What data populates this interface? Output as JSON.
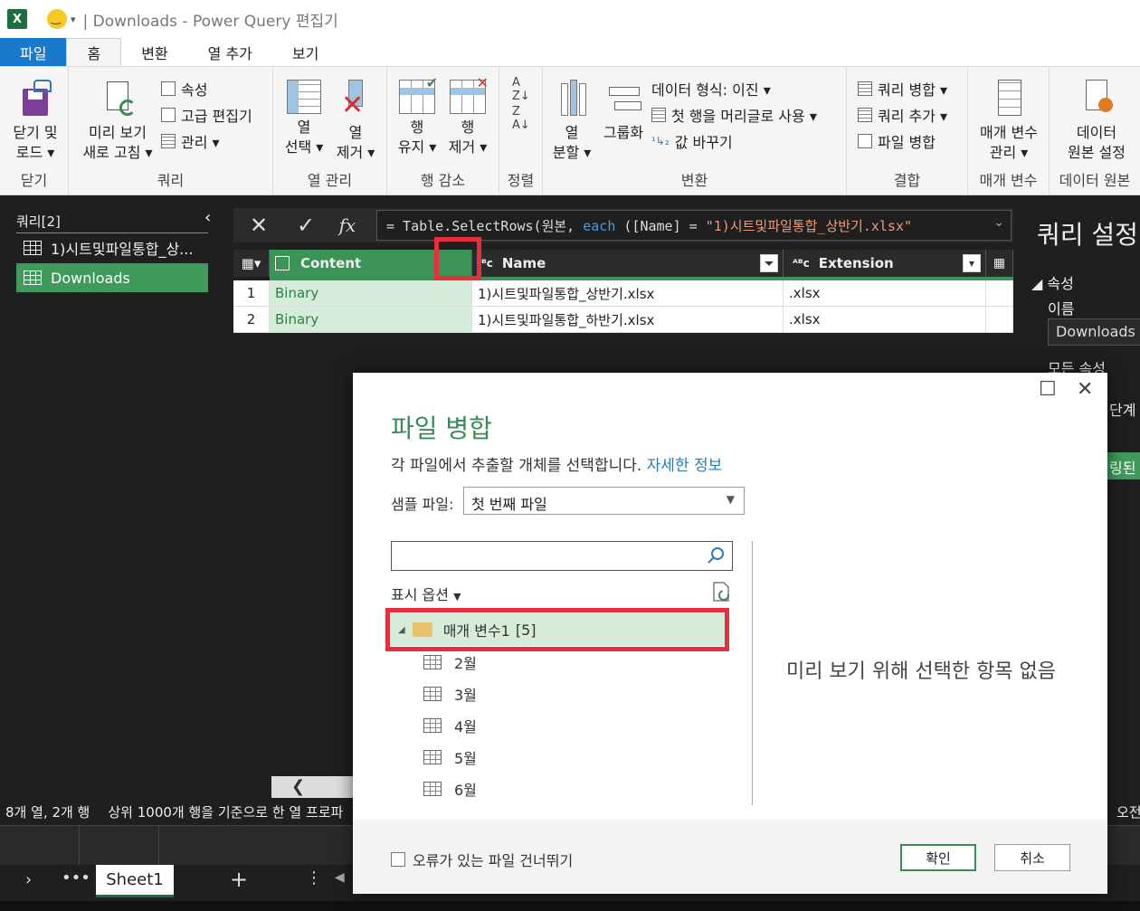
{
  "window": {
    "title": "| Downloads - Power Query 편집기",
    "app_icon": "X"
  },
  "tabs": [
    "파일",
    "홈",
    "변환",
    "열 추가",
    "보기"
  ],
  "ribbon": {
    "close_group": {
      "btn": "닫기 및",
      "btn2": "로드 ▾",
      "label": "닫기"
    },
    "query_group": {
      "refresh": "미리 보기",
      "refresh2": "새로 고침 ▾",
      "props": "속성",
      "adv": "고급 편집기",
      "manage": "관리 ▾",
      "label": "쿼리"
    },
    "cols_group": {
      "choose": "열",
      "choose2": "선택 ▾",
      "remove": "열",
      "remove2": "제거 ▾",
      "label": "열 관리"
    },
    "rows_group": {
      "keep": "행",
      "keep2": "유지 ▾",
      "remove": "행",
      "remove2": "제거 ▾",
      "label": "행 감소"
    },
    "sort_group": {
      "label": "정렬"
    },
    "transform_group": {
      "split": "열",
      "split2": "분할 ▾",
      "groupby": "그룹화",
      "dtype": "데이터 형식: 이진 ▾",
      "header": "첫 행을 머리글로 사용 ▾",
      "replace": "값 바꾸기",
      "label": "변환"
    },
    "combine_group": {
      "merge": "쿼리 병합 ▾",
      "append": "쿼리 추가 ▾",
      "files": "파일 병합",
      "label": "결합"
    },
    "params_group": {
      "manage": "매개 변수",
      "manage2": "관리 ▾",
      "label": "매개 변수"
    },
    "source_group": {
      "settings": "데이터",
      "settings2": "원본 설정",
      "label": "데이터 원본"
    }
  },
  "queries": {
    "header": "쿼리[2]",
    "items": [
      {
        "label": "1)시트및파일통합_상..."
      },
      {
        "label": "Downloads"
      }
    ]
  },
  "formula": {
    "prefix": "= Table.SelectRows(원본, ",
    "kw": "each",
    "mid": " ([Name] = ",
    "str": "\"1)시트및파일통합_상반기.xlsx\""
  },
  "grid": {
    "columns": [
      "Content",
      "Name",
      "Extension"
    ],
    "rows": [
      {
        "n": "1",
        "content": "Binary",
        "name": "1)시트및파일통합_상반기.xlsx",
        "ext": ".xlsx"
      },
      {
        "n": "2",
        "content": "Binary",
        "name": "1)시트및파일통합_하반기.xlsx",
        "ext": ".xlsx"
      }
    ]
  },
  "settings": {
    "title": "쿼리 설정",
    "props": "속성",
    "name_label": "이름",
    "name_value": "Downloads",
    "all_props": "모든 속성",
    "steps_fragment": "단계",
    "applied_fragment": "링된"
  },
  "status": {
    "left": "8개 열, 2개 행",
    "middle": "상위 1000개 행을 기준으로 한 열 프로파",
    "right": "오전"
  },
  "sheet": {
    "tab": "Sheet1"
  },
  "dialog": {
    "title": "파일 병합",
    "subtitle": "각 파일에서 추출할 개체를 선택합니다.",
    "link": "자세한 정보",
    "sample_label": "샘플 파일:",
    "sample_value": "첫 번째 파일",
    "display_options": "표시 옵션",
    "folder": "매개 변수1",
    "folder_count": "[5]",
    "items": [
      "2월",
      "3월",
      "4월",
      "5월",
      "6월"
    ],
    "preview": "미리 보기 위해 선택한 항목 없음",
    "skip_errors": "오류가 있는 파일 건너뛰기",
    "ok": "확인",
    "cancel": "취소"
  },
  "colors": {
    "accent": "#3a8a57",
    "highlight": "#e5303c",
    "file_tab": "#1979ca"
  }
}
